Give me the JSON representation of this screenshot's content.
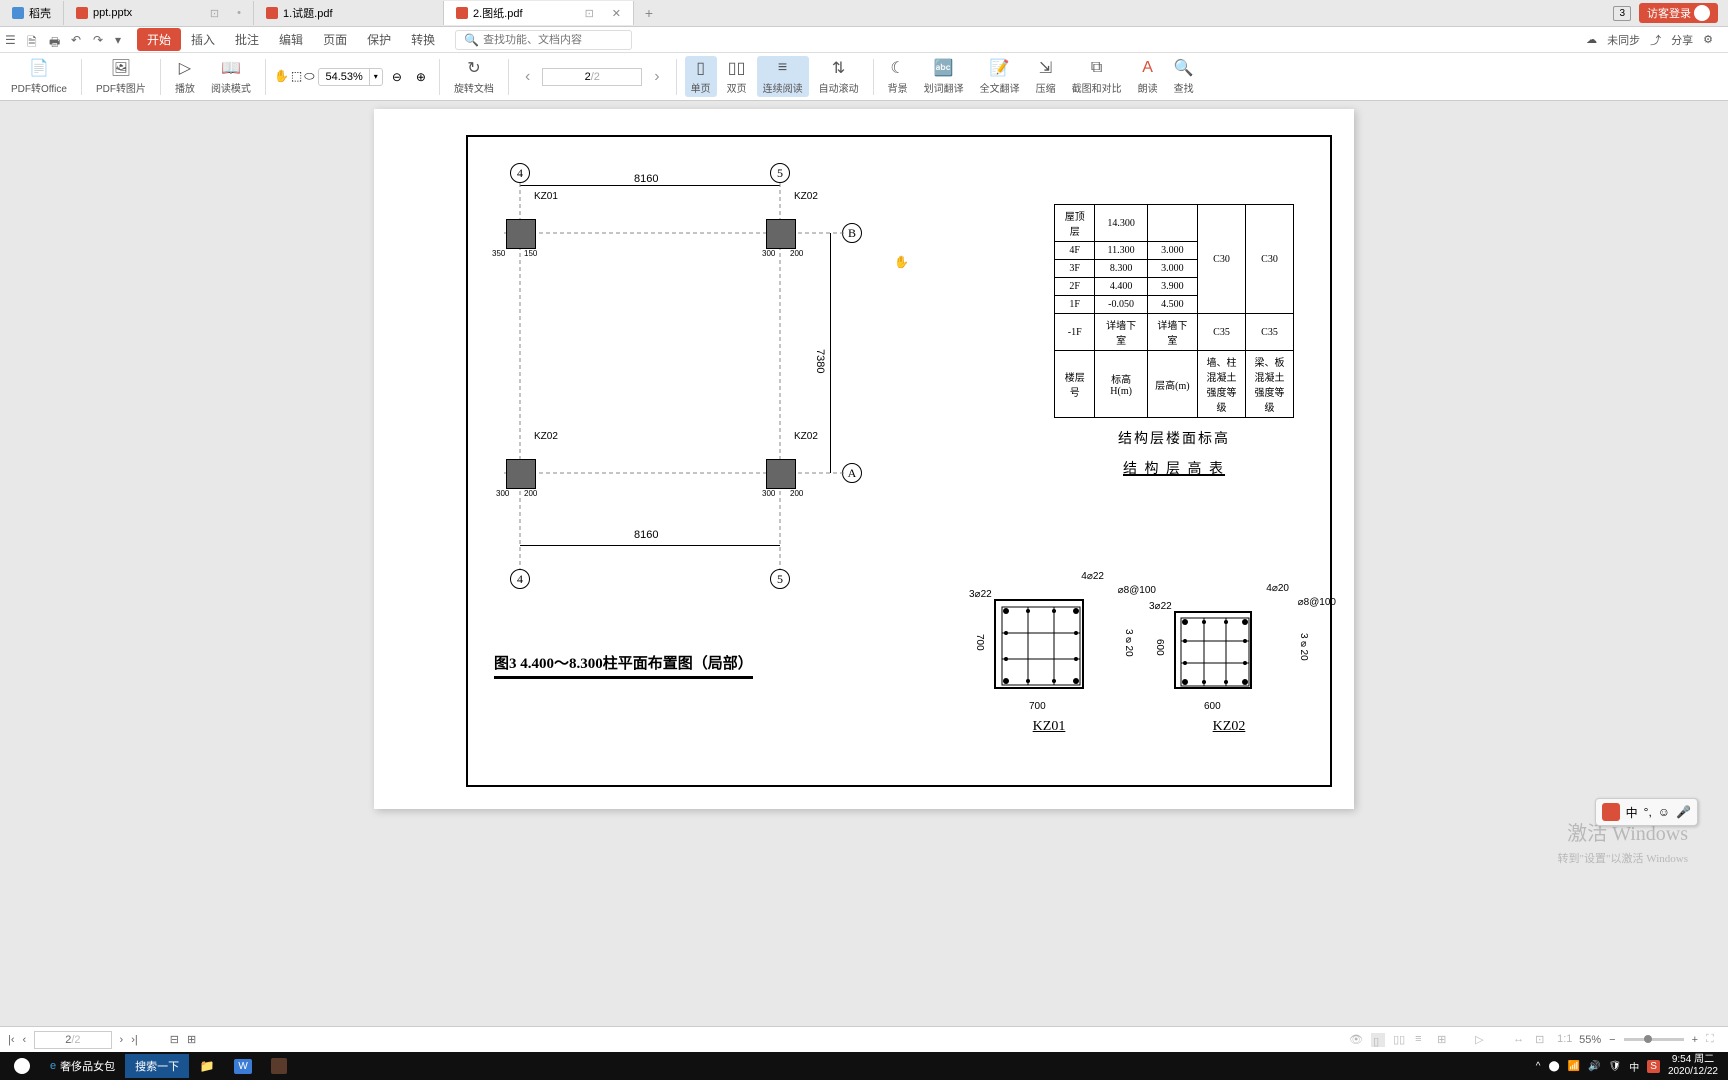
{
  "tabs": {
    "t0": "稻壳",
    "t1": "ppt.pptx",
    "t2": "1.试题.pdf",
    "t3": "2.图纸.pdf"
  },
  "tabIcons": {
    "badge": "3",
    "login": "访客登录"
  },
  "menu": {
    "start": "开始",
    "insert": "插入",
    "review": "批注",
    "edit": "编辑",
    "page": "页面",
    "protect": "保护",
    "convert": "转换",
    "searchPlaceholder": "查找功能、文档内容",
    "sync": "未同步",
    "share": "分享"
  },
  "toolbar": {
    "pdf2office": "PDF转Office",
    "pdf2pic": "PDF转图片",
    "play": "播放",
    "readmode": "阅读模式",
    "zoom": "54.53%",
    "rotate": "旋转文档",
    "singlePage": "单页",
    "doublePage": "双页",
    "contRead": "连续阅读",
    "autoScroll": "自动滚动",
    "bg": "背景",
    "wordTrans": "划词翻译",
    "fullTrans": "全文翻译",
    "compress": "压缩",
    "crop": "截图和对比",
    "read": "朗读",
    "find": "查找",
    "pageNum": "2",
    "pageTotal": "/2"
  },
  "drawing": {
    "figTitle": "图3 4.400～8.300柱平面布置图（局部）",
    "grids": {
      "g4": "4",
      "g5": "5",
      "gA": "A",
      "gB": "B"
    },
    "cols": {
      "kz01": "KZ01",
      "kz02": "KZ02"
    },
    "dims": {
      "h": "8160",
      "v": "7380",
      "c350": "350",
      "c150": "150",
      "c300": "300",
      "c200": "200"
    },
    "tableTitle1": "结构层楼面标高",
    "tableTitle2": "结 构 层 高 表",
    "kz01label": "KZ01",
    "kz02label": "KZ02",
    "sec1": {
      "w": "700",
      "h": "700",
      "top": "4⌀22",
      "side": "3⌀22",
      "stir": "⌀8@100",
      "sideR": "3⌀20"
    },
    "sec2": {
      "w": "600",
      "h": "600",
      "top": "4⌀20",
      "side": "3⌀22",
      "stir": "⌀8@100",
      "sideR": "3⌀20"
    }
  },
  "table": {
    "rows": [
      [
        "屋顶层",
        "14.300",
        "",
        "",
        ""
      ],
      [
        "4F",
        "11.300",
        "3.000",
        "",
        ""
      ],
      [
        "3F",
        "8.300",
        "3.000",
        "C30",
        "C30"
      ],
      [
        "2F",
        "4.400",
        "3.900",
        "",
        ""
      ],
      [
        "1F",
        "-0.050",
        "4.500",
        "",
        ""
      ],
      [
        "-1F",
        "详墙下室",
        "详墙下室",
        "C35",
        "C35"
      ],
      [
        "楼层号",
        "标高H(m)",
        "层高(m)",
        "墙、柱混凝土强度等级",
        "梁、板混凝土强度等级"
      ]
    ]
  },
  "bottomBar": {
    "page": "2",
    "total": "/2",
    "zoom": "55%"
  },
  "taskbar": {
    "app1": "奢侈品女包",
    "search": "搜索一下",
    "time": "9:54 周二",
    "date": "2020/12/22"
  },
  "watermark": {
    "l1": "激活 Windows",
    "l2": "转到\"设置\"以激活 Windows"
  },
  "ime": "中"
}
